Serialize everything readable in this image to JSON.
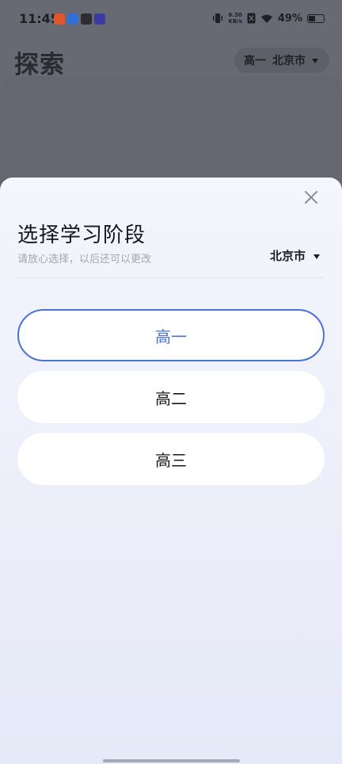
{
  "status_bar": {
    "time": "11:45",
    "net_speed_value": "6.30",
    "net_speed_unit": "KB/s",
    "battery_percent": "49%",
    "battery_level": 0.49,
    "notification_icons": [
      {
        "name": "app-notification-icon-1",
        "color": "#e2552b"
      },
      {
        "name": "app-notification-icon-2",
        "color": "#2f6fd8"
      },
      {
        "name": "app-notification-icon-3",
        "color": "#2b2d33"
      },
      {
        "name": "app-notification-icon-4",
        "color": "#3a3aa0"
      }
    ]
  },
  "background_page": {
    "title": "探索",
    "grade": "高一",
    "city": "北京市"
  },
  "sheet": {
    "title": "选择学习阶段",
    "subtitle": "请放心选择，以后还可以更改",
    "city": "北京市",
    "grades": [
      {
        "label": "高一",
        "selected": true
      },
      {
        "label": "高二",
        "selected": false
      },
      {
        "label": "高三",
        "selected": false
      }
    ]
  },
  "colors": {
    "accent": "#4d72d6",
    "sheet_background": "#f4f6fd",
    "overlay": "#6b6d75"
  }
}
